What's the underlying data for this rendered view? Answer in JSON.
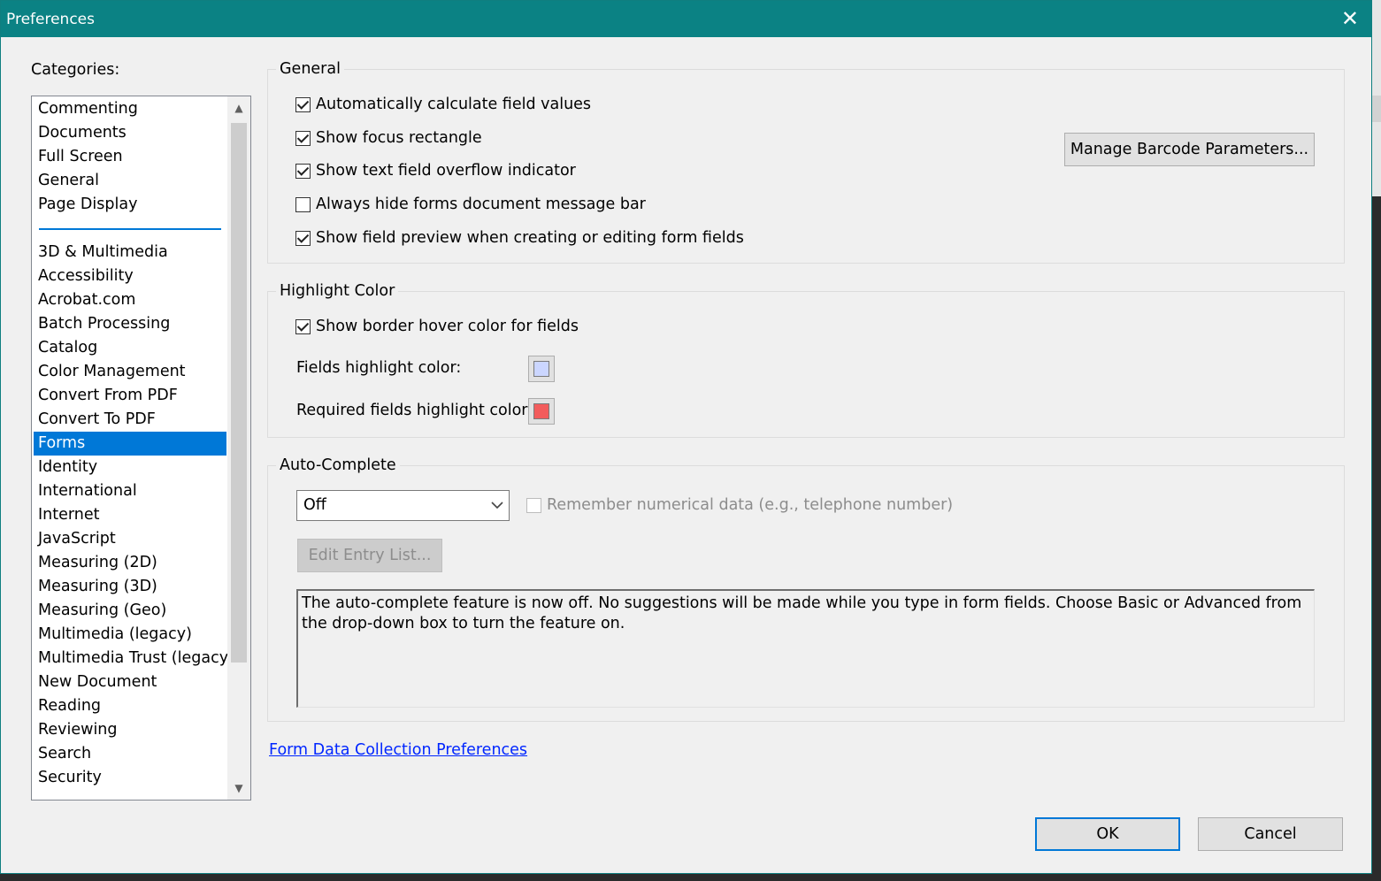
{
  "window": {
    "title": "Preferences",
    "close_glyph": "✕"
  },
  "categories": {
    "label": "Categories:",
    "top_items": [
      "Commenting",
      "Documents",
      "Full Screen",
      "General",
      "Page Display"
    ],
    "items": [
      "3D & Multimedia",
      "Accessibility",
      "Acrobat.com",
      "Batch Processing",
      "Catalog",
      "Color Management",
      "Convert From PDF",
      "Convert To PDF",
      "Forms",
      "Identity",
      "International",
      "Internet",
      "JavaScript",
      "Measuring (2D)",
      "Measuring (3D)",
      "Measuring (Geo)",
      "Multimedia (legacy)",
      "Multimedia Trust (legacy)",
      "New Document",
      "Reading",
      "Reviewing",
      "Search",
      "Security"
    ],
    "selected": "Forms",
    "scroll_up_glyph": "▲",
    "scroll_down_glyph": "▼"
  },
  "general": {
    "legend": "General",
    "checkboxes": [
      {
        "label": "Automatically calculate field values",
        "checked": true
      },
      {
        "label": "Show focus rectangle",
        "checked": true
      },
      {
        "label": "Show text field overflow indicator",
        "checked": true
      },
      {
        "label": "Always hide forms document message bar",
        "checked": false
      },
      {
        "label": "Show field preview when creating or editing form fields",
        "checked": true
      }
    ],
    "barcode_button": "Manage Barcode Parameters..."
  },
  "highlight": {
    "legend": "Highlight Color",
    "hover_checkbox": {
      "label": "Show border hover color for fields",
      "checked": true
    },
    "fields_label": "Fields highlight color:",
    "fields_color": "#cbd6ff",
    "required_label": "Required fields highlight color:",
    "required_color": "#f25c5c"
  },
  "autocomplete": {
    "legend": "Auto-Complete",
    "select_value": "Off",
    "remember_label": "Remember numerical data (e.g., telephone number)",
    "remember_checked": false,
    "edit_button": "Edit Entry List...",
    "description": "The auto-complete feature is now off. No suggestions will be made while you type in form fields. Choose Basic or Advanced from the drop-down box to turn the feature on."
  },
  "link": {
    "label": "Form Data Collection Preferences"
  },
  "buttons": {
    "ok": "OK",
    "cancel": "Cancel"
  },
  "colors": {
    "title_bar": "#0b8284",
    "selection": "#0078d7",
    "link": "#0026ff"
  }
}
